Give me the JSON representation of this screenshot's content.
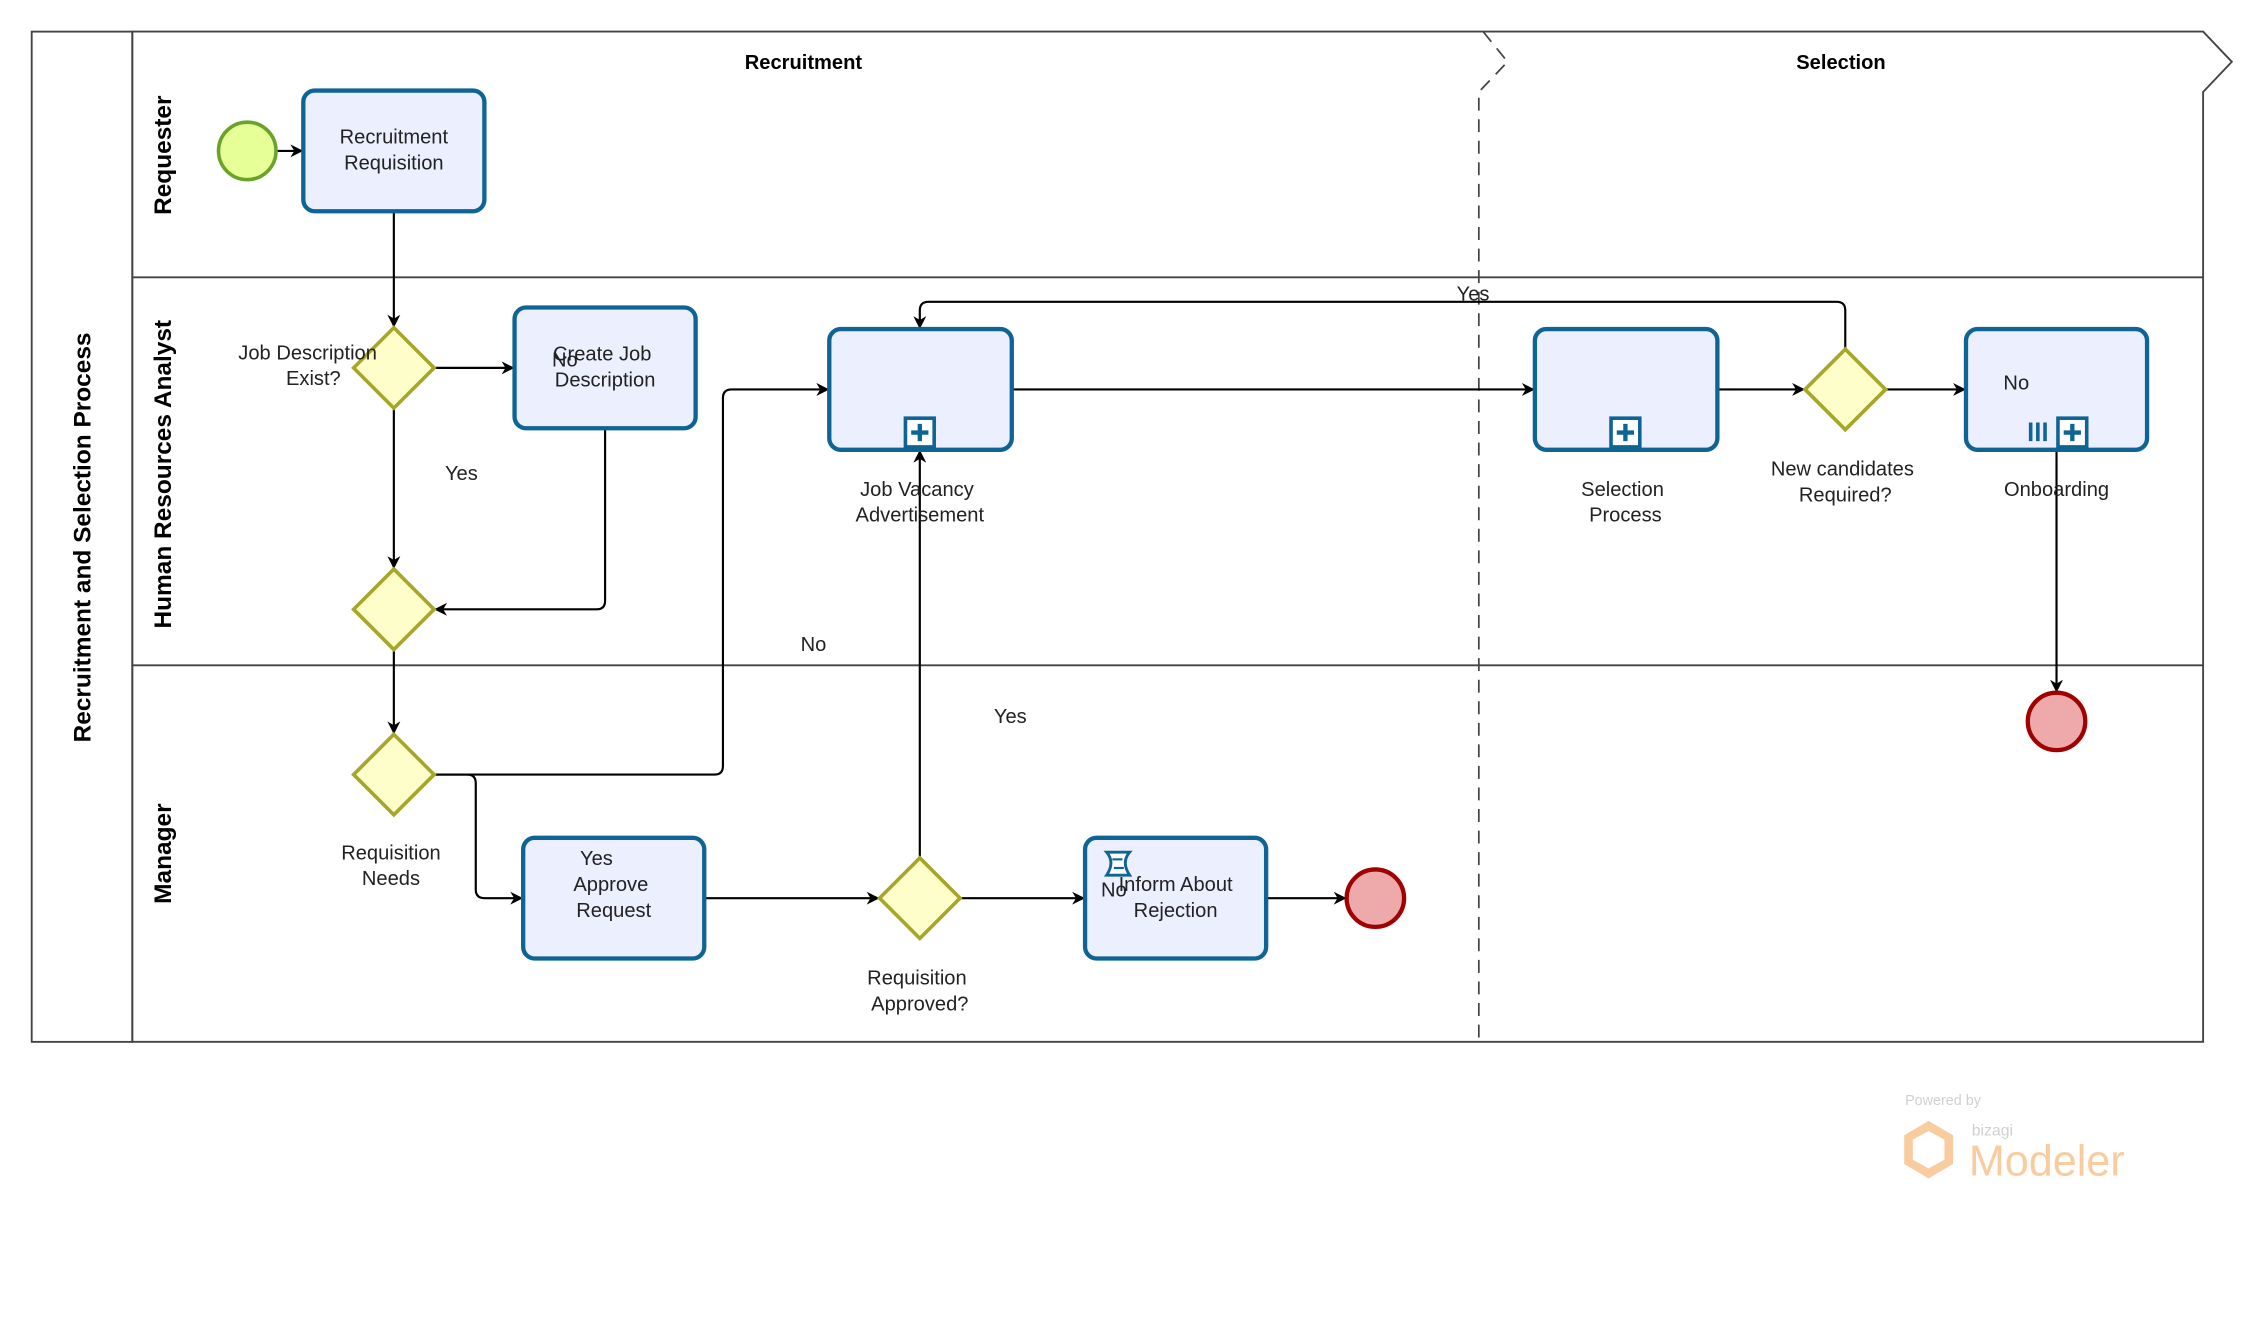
{
  "pool": {
    "title": "Recruitment and Selection Process"
  },
  "lanes": [
    {
      "label": "Requester"
    },
    {
      "label": "Human Resources Analyst"
    },
    {
      "label": "Manager"
    }
  ],
  "phases": [
    {
      "label": "Recruitment"
    },
    {
      "label": "Selection"
    }
  ],
  "tasks": {
    "recruitment_requisition": [
      "Recruitment",
      "Requisition"
    ],
    "create_job_description": [
      "Create Job",
      "Description"
    ],
    "approve_request": [
      "Approve",
      "Request"
    ],
    "inform_rejection": [
      "Inform About",
      "Rejection"
    ],
    "job_vacancy": [
      "Job Vacancy",
      "Advertisement"
    ],
    "selection_process": [
      "Selection",
      "Process"
    ],
    "onboarding": [
      "Onboarding"
    ]
  },
  "gateways": {
    "job_description_exist": [
      "Job Description",
      "Exist?"
    ],
    "requisition_needs": [
      "Requisition",
      "Needs"
    ],
    "requisition_approved": [
      "Requisition",
      "Approved?"
    ],
    "new_candidates": [
      "New candidates",
      "Required?"
    ]
  },
  "flow_labels": {
    "jd_no": "No",
    "jd_yes": "Yes",
    "needs_no": "No",
    "needs_yes": "Yes",
    "approved_yes": "Yes",
    "approved_no": "No",
    "candidates_yes": "Yes",
    "candidates_no": "No"
  },
  "watermark": {
    "powered_by": "Powered by",
    "brand": "bizagi",
    "product": "Modeler"
  },
  "colors": {
    "task_fill": "#eceffe",
    "task_stroke": "#0f6496",
    "gateway_fill": "#fefecb",
    "gateway_stroke": "#a6a629",
    "start_fill": "#e6ff97",
    "start_stroke": "#6aa329",
    "end_fill": "#eeaaaa",
    "end_stroke": "#a00000",
    "watermark": "#f7c48e"
  }
}
